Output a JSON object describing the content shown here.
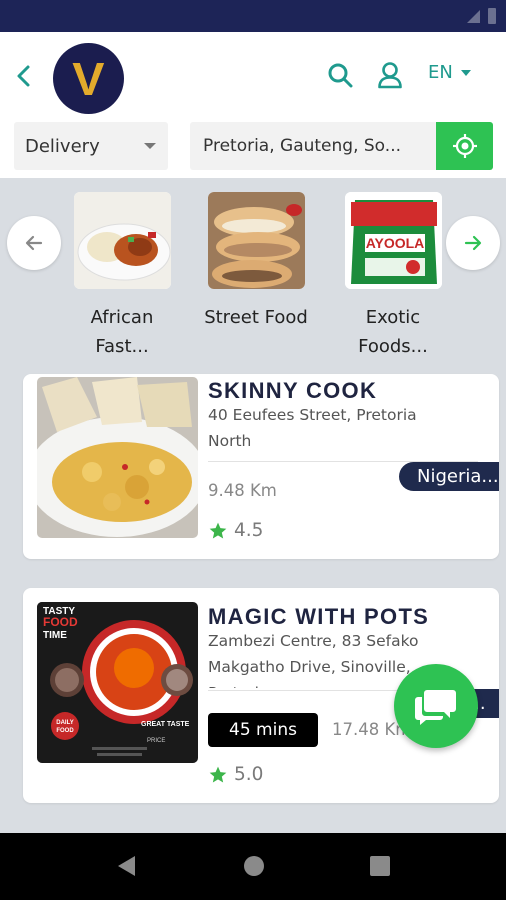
{
  "header": {
    "logo_letter": "V",
    "language": "EN"
  },
  "filters": {
    "mode_value": "Delivery",
    "location_value": "Pretoria, Gauteng, So..."
  },
  "categories": [
    {
      "label_line1": "African",
      "label_line2": "Fast..."
    },
    {
      "label_line1": "Street Food",
      "label_line2": ""
    },
    {
      "label_line1": "Exotic",
      "label_line2": "Foods..."
    }
  ],
  "category_brand": {
    "name": "AYOOLA"
  },
  "restaurants": [
    {
      "name": "SKINNY COOK",
      "address_line1": "40 Eeufees Street, Pretoria",
      "address_line2": "North",
      "tag": "Nigeria...",
      "distance": "9.48 Km",
      "rating": "4.5"
    },
    {
      "name": "MAGIC WITH POTS",
      "address_line1": "Zambezi Centre, 83 Sefako",
      "address_line2": "Makgatho Drive, Sinoville,",
      "address_line3": "Pretoria",
      "tag": "d...",
      "delivery_time": "45 mins",
      "distance": "17.48 Km",
      "rating": "5.0",
      "poster": {
        "headline_1": "TASTY",
        "headline_2": "FOOD",
        "headline_3": "TIME",
        "badge_1": "DAILY",
        "badge_2": "FOOD",
        "tagline_1": "GREAT TASTE",
        "tagline_2": "PRICE"
      }
    }
  ],
  "colors": {
    "accent_teal": "#1f9a8e",
    "accent_green": "#2ec253",
    "status_bar": "#1d2457",
    "tag_bg": "#1f2a4d",
    "star": "#3cb54a"
  },
  "icons": [
    "back-arrow-icon",
    "search-icon",
    "user-icon",
    "caret-down-icon",
    "location-target-icon",
    "arrow-left-icon",
    "arrow-right-icon",
    "star-icon",
    "chat-icon",
    "nav-back-icon",
    "nav-home-icon",
    "nav-recents-icon"
  ]
}
